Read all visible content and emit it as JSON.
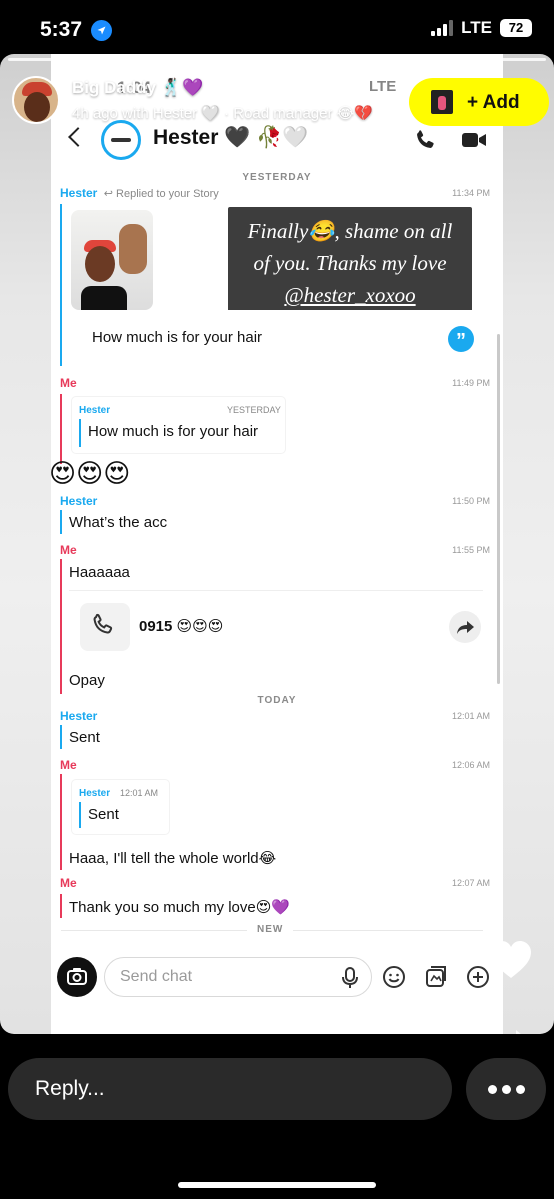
{
  "status_bar": {
    "time": "5:37",
    "network": "LTE",
    "battery": "72"
  },
  "story": {
    "username": "Big Daddy 🕺🏿💜",
    "meta": "4h ago with Hester 🤍 · Road manager 😂💔",
    "add_label": "+ Add"
  },
  "screenshot": {
    "status_time": "1:04",
    "status_network": "LTE",
    "header": {
      "name": "Hester 🖤 🥀🤍"
    },
    "days": {
      "yesterday": "YESTERDAY",
      "today": "TODAY",
      "new": "NEW"
    },
    "story_reply": {
      "sender": "Hester",
      "note": "Replied to your Story",
      "time": "11:34 PM",
      "caption_line1": "Finally😂, shame on all",
      "caption_line2": "of you. Thanks my love",
      "caption_handle": "@hester_xoxoo",
      "text": "How much is for your hair"
    },
    "messages": [
      {
        "sender": "Me",
        "time": "11:49 PM",
        "quote_sender": "Hester",
        "quote_time": "YESTERDAY",
        "quote_text": "How much is for your hair",
        "reaction": "😍😍😍"
      },
      {
        "sender": "Hester",
        "time": "11:50 PM",
        "text": "What’s the acc"
      },
      {
        "sender": "Me",
        "time": "11:55 PM",
        "text": "Haaaaaa",
        "call_number": "0915 😍😍😍",
        "text2": "Opay"
      },
      {
        "sender": "Hester",
        "time": "12:01 AM",
        "text": "Sent"
      },
      {
        "sender": "Me",
        "time": "12:06 AM",
        "quote_sender": "Hester",
        "quote_time": "12:01 AM",
        "quote_text": "Sent",
        "text": "Haaa, I'll tell the whole world😂"
      },
      {
        "sender": "Me",
        "time": "12:07 AM",
        "text": "Thank you so much my love😍💜"
      }
    ],
    "composer": {
      "placeholder": "Send chat"
    }
  },
  "reply_bar": {
    "label": "Reply..."
  },
  "colors": {
    "snap_yellow": "#fffc00",
    "hester_blue": "#1aa9ef",
    "me_red": "#e73a5a"
  }
}
